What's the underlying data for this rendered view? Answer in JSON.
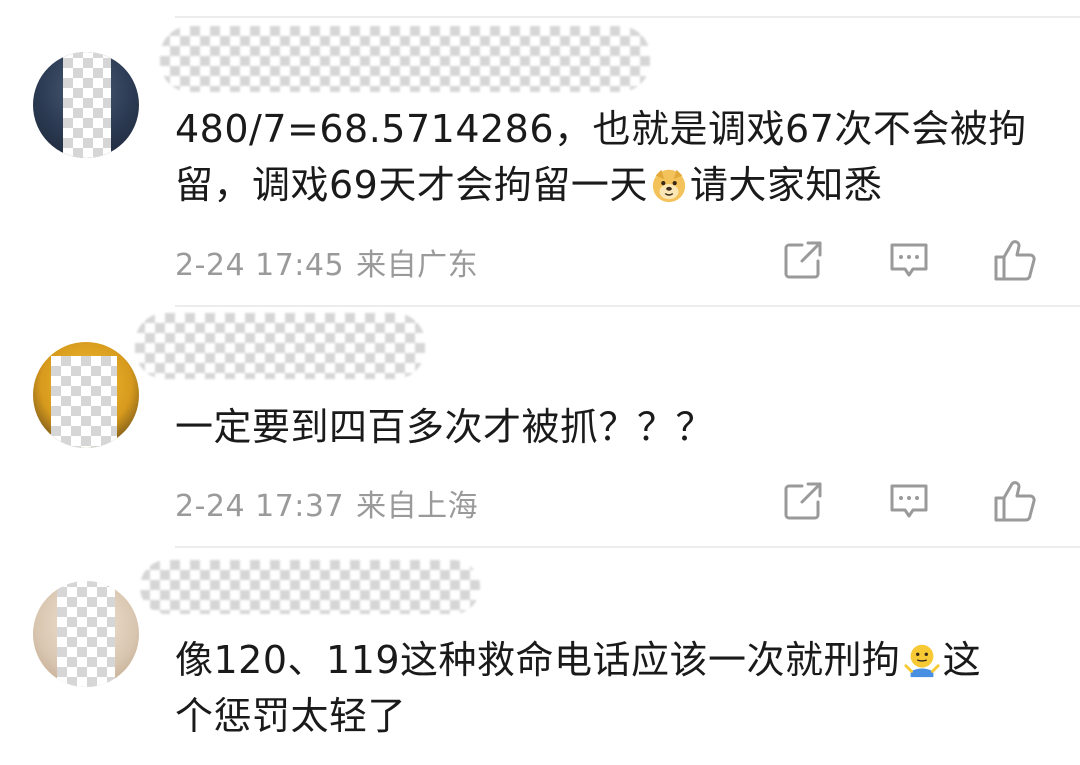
{
  "comments": [
    {
      "text_line1": "480/7=68.5714286，也就是调戏67次不会被拘",
      "text_line2a": "留，调戏69天才会拘留一天",
      "text_line2b": "请大家知悉",
      "emoji": "doge-emoji",
      "time": "2-24 17:45",
      "location": "来自广东",
      "avatar_color": "#2b3a52"
    },
    {
      "text": "一定要到四百多次才被抓？？？",
      "time": "2-24 17:37",
      "location": "来自上海",
      "avatar_color": "#c7921f"
    },
    {
      "text_line1a": "像120、119这种救命电话应该一次就刑拘",
      "text_line1b": "这",
      "text_line2": "个惩罚太轻了",
      "emoji": "shrug-emoji",
      "avatar_color": "#d9c6b0"
    }
  ],
  "actions": {
    "share_icon": "share-icon",
    "reply_icon": "comment-icon",
    "like_icon": "thumbs-up-icon"
  }
}
